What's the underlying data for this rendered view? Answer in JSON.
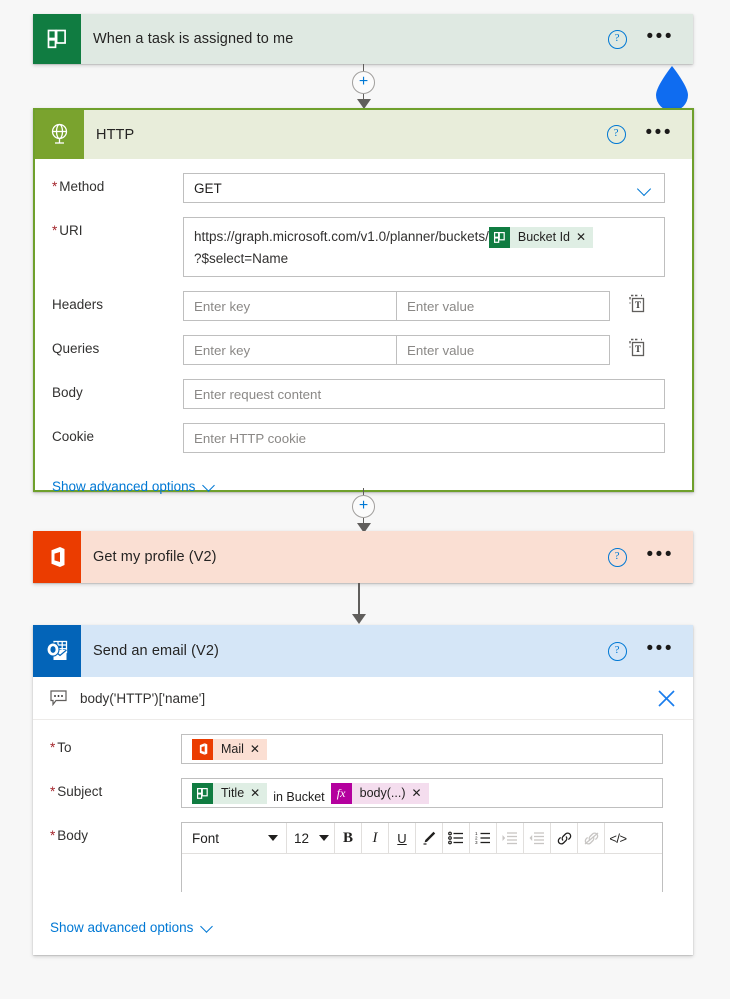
{
  "flow": {
    "trigger": {
      "title": "When a task is assigned to me",
      "icon": "planner-icon",
      "help_label": "?",
      "menu_label": "•••"
    },
    "http_action": {
      "title": "HTTP",
      "icon": "http-globe-icon",
      "method": {
        "label": "Method",
        "value": "GET",
        "required": true
      },
      "uri": {
        "label": "URI",
        "required": true,
        "text_before": "https://graph.microsoft.com/v1.0/planner/buckets/",
        "token": {
          "label": "Bucket Id",
          "icon": "planner-icon",
          "remove": "✕"
        },
        "text_after": "?$select=Name"
      },
      "headers": {
        "label": "Headers",
        "key_placeholder": "Enter key",
        "value_placeholder": "Enter value",
        "text_mode_icon": "switch-to-text-mode-icon"
      },
      "queries": {
        "label": "Queries",
        "key_placeholder": "Enter key",
        "value_placeholder": "Enter value",
        "text_mode_icon": "switch-to-text-mode-icon"
      },
      "body": {
        "label": "Body",
        "placeholder": "Enter request content"
      },
      "cookie": {
        "label": "Cookie",
        "placeholder": "Enter HTTP cookie"
      },
      "advanced_label": "Show advanced options"
    },
    "profile_action": {
      "title": "Get my profile (V2)",
      "icon": "office365-users-icon"
    },
    "email_action": {
      "title": "Send an email (V2)",
      "icon": "outlook-icon",
      "expression": {
        "icon": "comment-icon",
        "text": "body('HTTP')['name']",
        "close_icon": "close-icon"
      },
      "to": {
        "label": "To",
        "required": true,
        "token": {
          "label": "Mail",
          "icon": "office365-users-icon",
          "remove": "✕"
        }
      },
      "subject": {
        "label": "Subject",
        "required": true,
        "token1": {
          "label": "Title",
          "icon": "planner-icon",
          "remove": "✕"
        },
        "static_text": "in Bucket",
        "token2": {
          "label": "body(...)",
          "icon": "expression-fx-icon",
          "remove": "✕"
        }
      },
      "body": {
        "label": "Body",
        "required": true,
        "toolbar": {
          "font_name": "Font",
          "font_size": "12",
          "bold": "B",
          "italic": "I",
          "underline": "U",
          "highlight": "highlight-pen-icon",
          "bulleted_list": "bulleted-list-icon",
          "numbered_list": "numbered-list-icon",
          "indent": "indent-icon",
          "outdent": "outdent-icon",
          "link": "link-icon",
          "unlink": "unlink-icon",
          "code_view": "</>"
        },
        "content": ""
      },
      "advanced_label": "Show advanced options"
    },
    "connectors": {
      "add_step_label": "+"
    },
    "cursor": {
      "shape": "water-drop-cursor",
      "color": "#0f6cf0"
    }
  },
  "colors": {
    "planner_green": "#107c41",
    "http_olive": "#7aa32e",
    "http_border": "#6fa02c",
    "office_orange": "#eb3c00",
    "outlook_blue": "#0364b8",
    "accent_blue": "#0078d4",
    "required_red": "#a4262c",
    "expression_magenta": "#b4009e",
    "page_background": "#f7f7f7"
  }
}
